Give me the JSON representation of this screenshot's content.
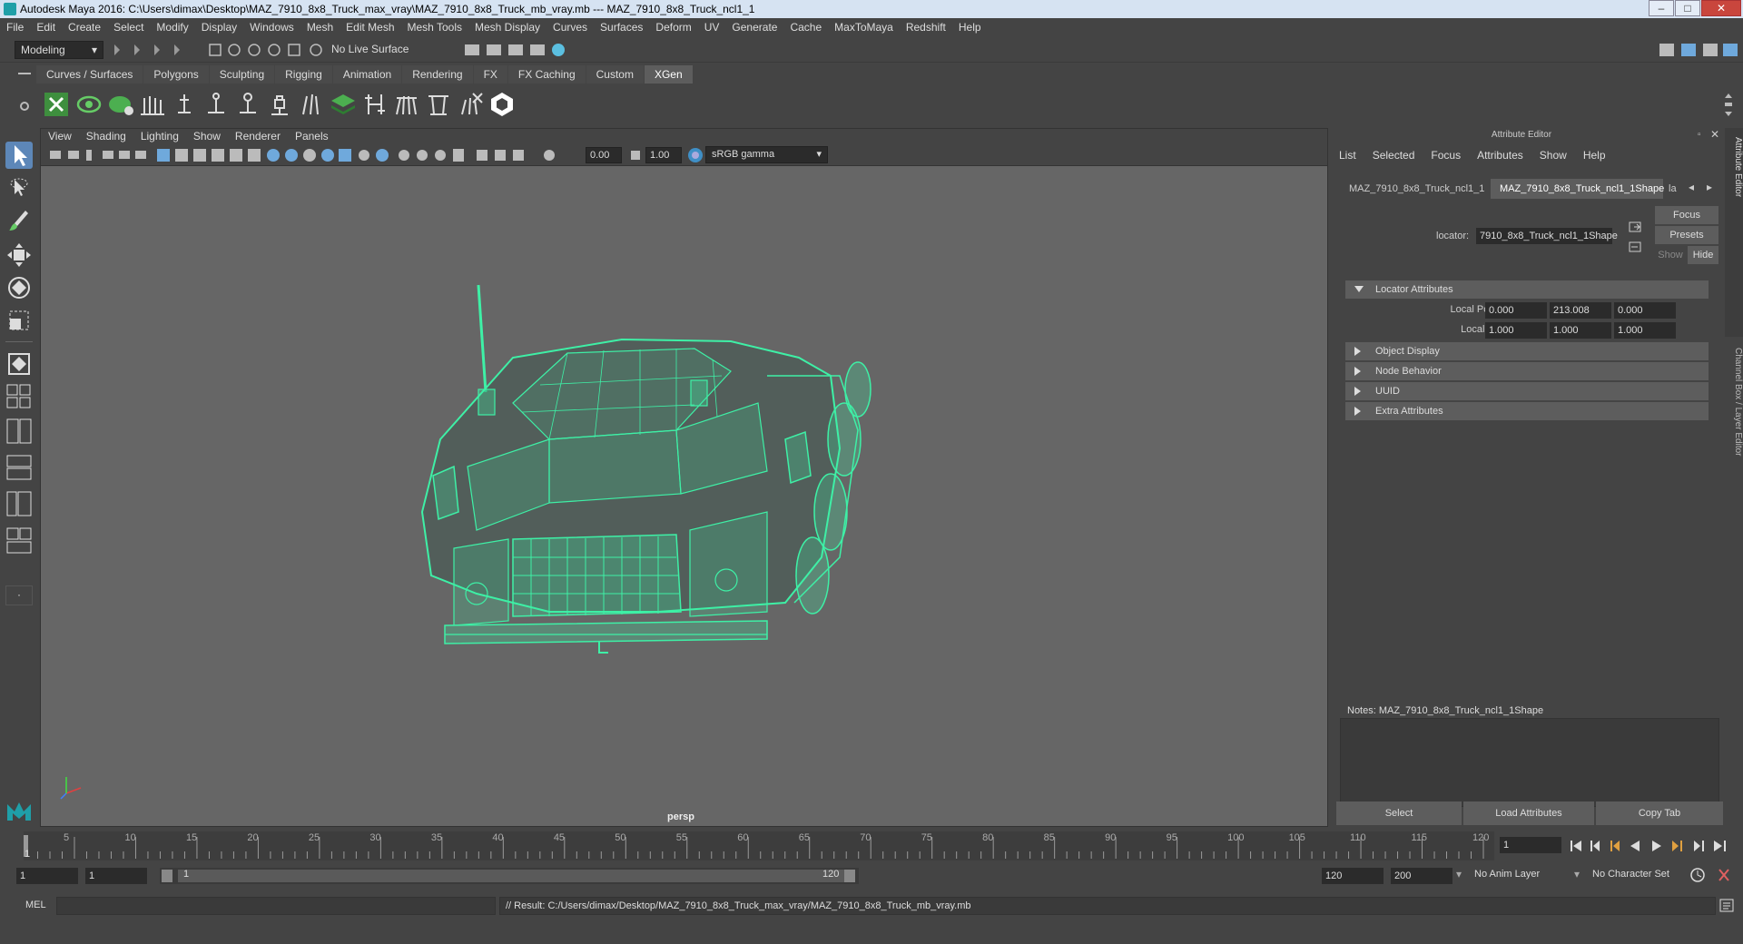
{
  "titlebar": {
    "title": "Autodesk Maya 2016: C:\\Users\\dimax\\Desktop\\MAZ_7910_8x8_Truck_max_vray\\MAZ_7910_8x8_Truck_mb_vray.mb   ---   MAZ_7910_8x8_Truck_ncl1_1"
  },
  "menubar": [
    "File",
    "Edit",
    "Create",
    "Select",
    "Modify",
    "Display",
    "Windows",
    "Mesh",
    "Edit Mesh",
    "Mesh Tools",
    "Mesh Display",
    "Curves",
    "Surfaces",
    "Deform",
    "UV",
    "Generate",
    "Cache",
    "MaxToMaya",
    "Redshift",
    "Help"
  ],
  "statusline": {
    "mode": "Modeling",
    "live_surface": "No Live Surface"
  },
  "shelf_tabs": [
    "Curves / Surfaces",
    "Polygons",
    "Sculpting",
    "Rigging",
    "Animation",
    "Rendering",
    "FX",
    "FX Caching",
    "Custom",
    "XGen"
  ],
  "active_shelf_tab": "XGen",
  "viewport": {
    "menu": [
      "View",
      "Shading",
      "Lighting",
      "Show",
      "Renderer",
      "Panels"
    ],
    "exposure": "0.00",
    "gamma": "1.00",
    "color_space": "sRGB gamma",
    "camera_label": "persp"
  },
  "attribute_editor": {
    "header": "Attribute Editor",
    "menu": [
      "List",
      "Selected",
      "Focus",
      "Attributes",
      "Show",
      "Help"
    ],
    "tabs": [
      "MAZ_7910_8x8_Truck_ncl1_1",
      "MAZ_7910_8x8_Truck_ncl1_1Shape",
      "la"
    ],
    "active_tab": 1,
    "locator_label": "locator:",
    "locator_value": "7910_8x8_Truck_ncl1_1Shape",
    "focus_btn": "Focus",
    "presets_btn": "Presets",
    "show_btn": "Show",
    "hide_btn": "Hide",
    "sections": [
      {
        "label": "Locator Attributes",
        "expanded": true
      },
      {
        "label": "Object Display",
        "expanded": false
      },
      {
        "label": "Node Behavior",
        "expanded": false
      },
      {
        "label": "UUID",
        "expanded": false
      },
      {
        "label": "Extra Attributes",
        "expanded": false
      }
    ],
    "local_position_label": "Local Position",
    "local_position": [
      "0.000",
      "213.008",
      "0.000"
    ],
    "local_scale_label": "Local Scale",
    "local_scale": [
      "1.000",
      "1.000",
      "1.000"
    ],
    "notes_label": "Notes:  MAZ_7910_8x8_Truck_ncl1_1Shape",
    "select_btn": "Select",
    "load_btn": "Load Attributes",
    "copy_btn": "Copy Tab",
    "side_tabs": [
      "Attribute Editor",
      "Channel Box / Layer Editor"
    ]
  },
  "timeline": {
    "ticks": [
      "5",
      "10",
      "15",
      "20",
      "25",
      "30",
      "35",
      "40",
      "45",
      "50",
      "55",
      "60",
      "65",
      "70",
      "75",
      "80",
      "85",
      "90",
      "95",
      "100",
      "105",
      "110",
      "115",
      "120"
    ],
    "first_tick": "1",
    "current_frame": "1"
  },
  "range": {
    "start": "1",
    "start2": "1",
    "slider_start": "1",
    "slider_end": "120",
    "end": "120",
    "end2": "200",
    "anim_layer": "No Anim Layer",
    "char_set": "No Character Set"
  },
  "cmdline": {
    "lang": "MEL",
    "result": "// Result: C:/Users/dimax/Desktop/MAZ_7910_8x8_Truck_max_vray/MAZ_7910_8x8_Truck_mb_vray.mb"
  },
  "colors": {
    "wire": "#3ef0a6",
    "viewport_bg": "#666666",
    "ui_bg": "#444444"
  }
}
